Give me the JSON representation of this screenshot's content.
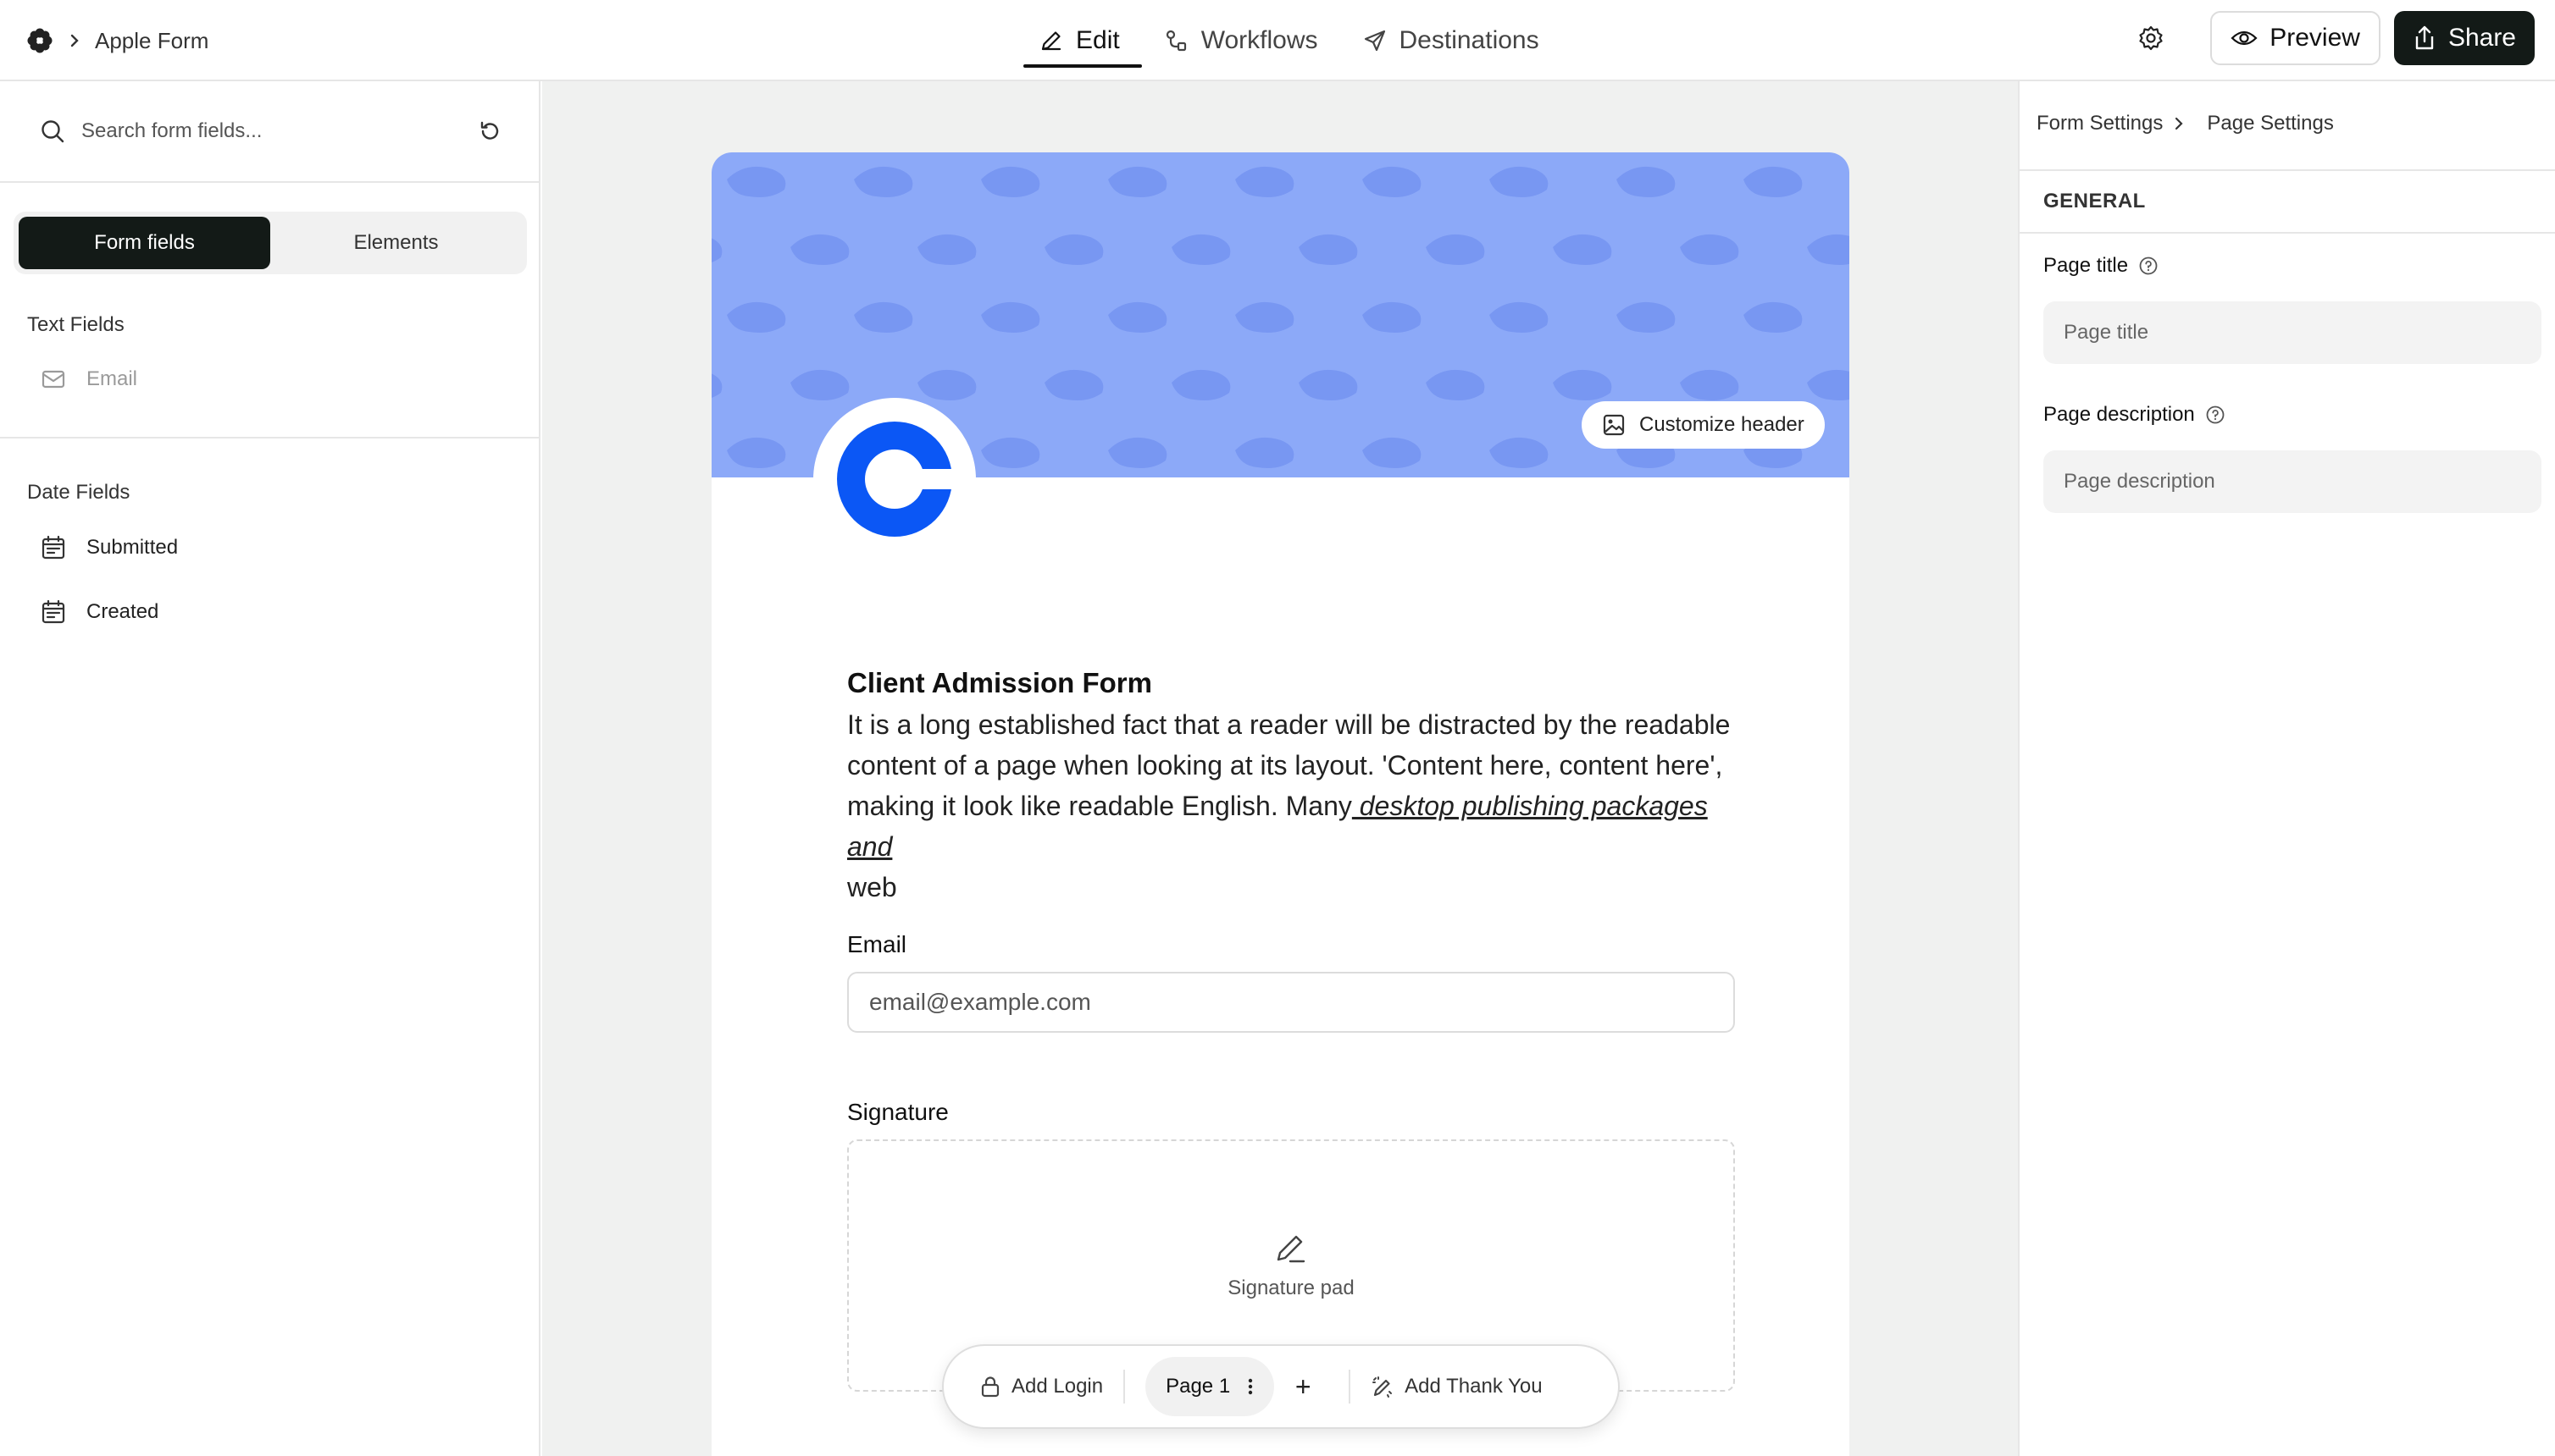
{
  "app": {
    "breadcrumb": "Apple Form",
    "logo_icon": "flower-logo-icon"
  },
  "tabs": [
    {
      "label": "Edit",
      "icon": "pencil-icon",
      "active": true
    },
    {
      "label": "Workflows",
      "icon": "workflow-icon",
      "active": false
    },
    {
      "label": "Destinations",
      "icon": "send-icon",
      "active": false
    }
  ],
  "actions": {
    "preview_label": "Preview",
    "share_label": "Share"
  },
  "left": {
    "search_placeholder": "Search form fields...",
    "toggle": [
      "Form fields",
      "Elements"
    ],
    "text_fields_title": "Text Fields",
    "text_fields": [
      {
        "label": "Email",
        "icon": "mail-icon"
      }
    ],
    "date_fields_title": "Date Fields",
    "date_fields": [
      {
        "label": "Submitted",
        "icon": "calendar-icon"
      },
      {
        "label": "Created",
        "icon": "calendar-icon"
      }
    ]
  },
  "form": {
    "customize_label": "Customize header",
    "header_color": "#8ca9f8",
    "logo_color": "#0b57f5",
    "title": "Client Admission Form",
    "desc_text": "It is a long established fact that a reader will be distracted by the readable content of a page when looking at its layout. 'Content here, content here', making it look like readable English. Many",
    "desc_link": " desktop publishing packages and",
    "desc_tail": "web",
    "email_label": "Email",
    "email_placeholder": "email@example.com",
    "signature_label": "Signature",
    "signature_pad": "Signature pad"
  },
  "page_bar": {
    "add_login": "Add Login",
    "page": "Page 1",
    "plus": "+",
    "add_thank_you": "Add Thank You"
  },
  "right": {
    "crumb_1": "Form Settings",
    "crumb_2": "Page Settings",
    "section": "GENERAL",
    "page_title_label": "Page title",
    "page_title_placeholder": "Page title",
    "page_desc_label": "Page description",
    "page_desc_placeholder": "Page description"
  }
}
